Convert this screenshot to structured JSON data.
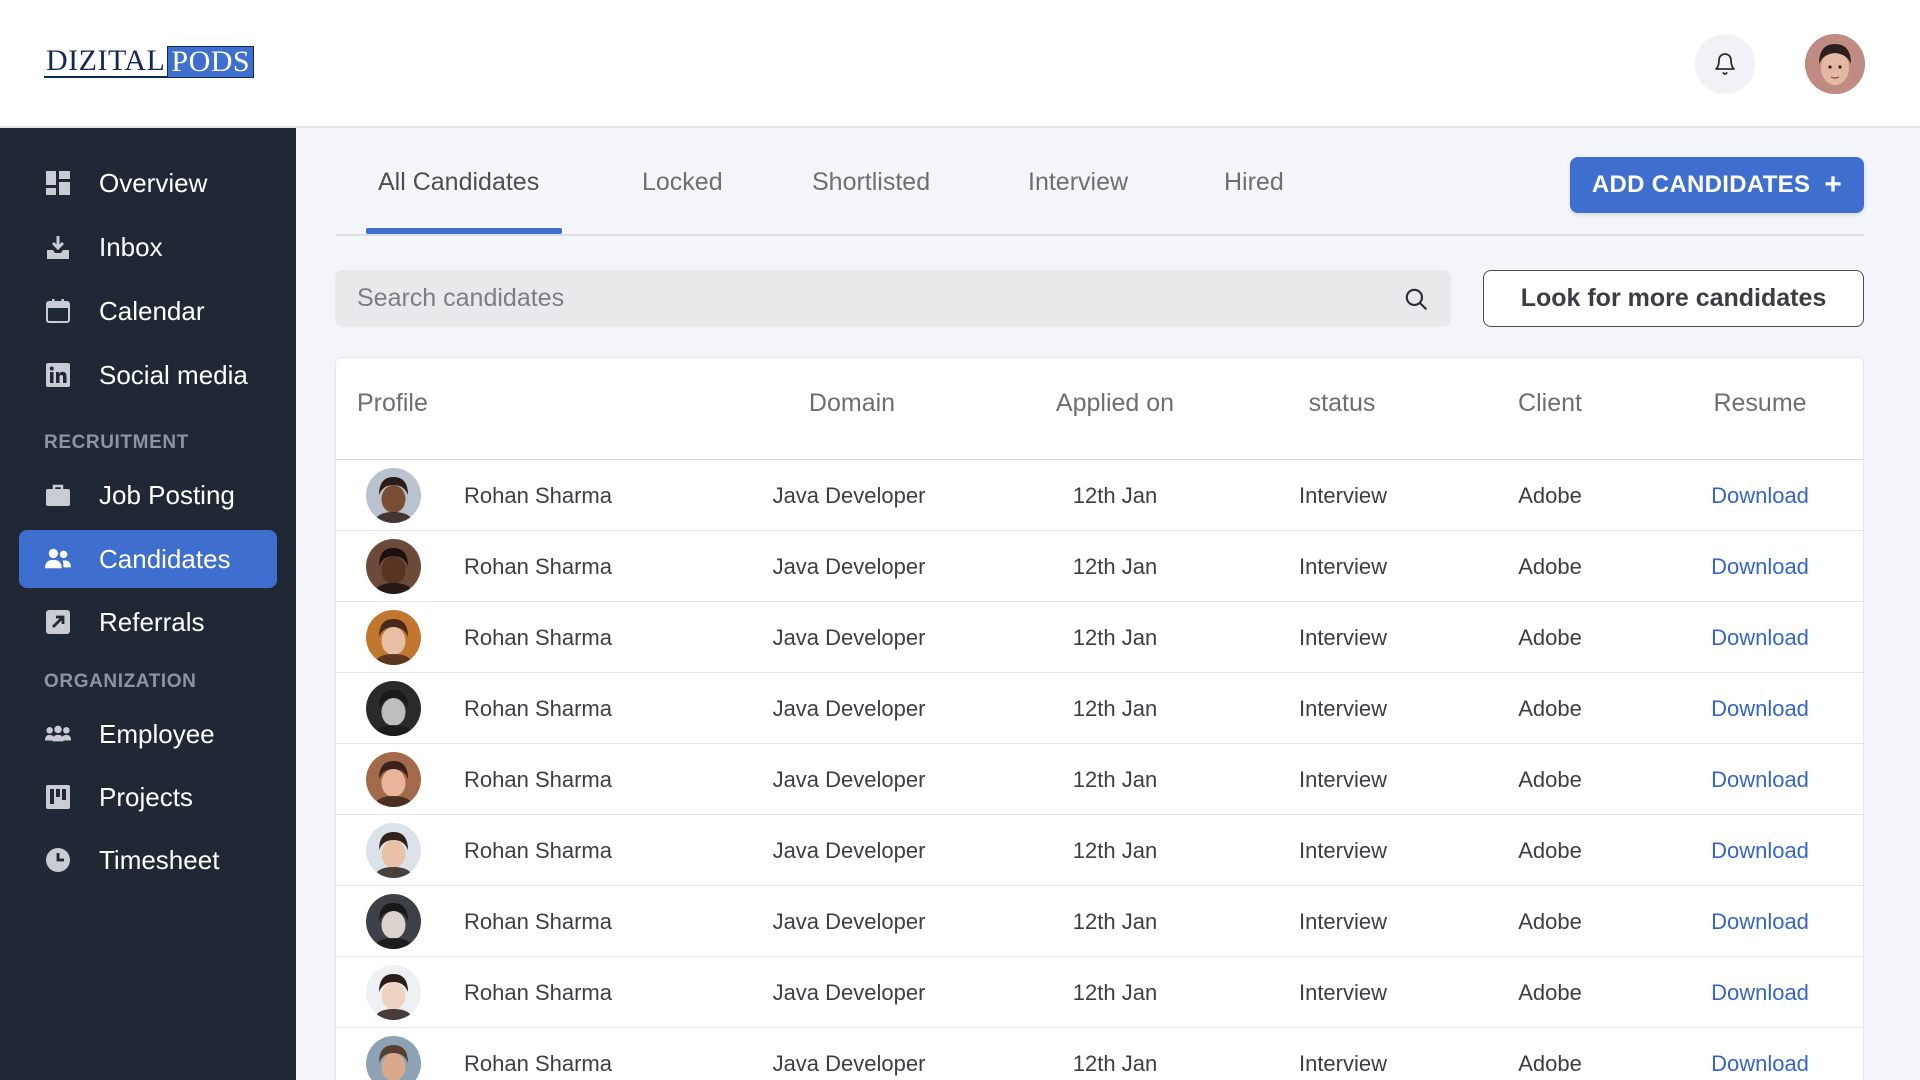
{
  "header": {
    "logo": {
      "part1": "DIZITAL",
      "part2": "PODS"
    }
  },
  "sidebar": {
    "items": [
      {
        "label": "Overview",
        "icon": "dashboard-icon"
      },
      {
        "label": "Inbox",
        "icon": "inbox-download-icon"
      },
      {
        "label": "Calendar",
        "icon": "calendar-icon"
      },
      {
        "label": "Social media",
        "icon": "linkedin-icon"
      }
    ],
    "section_recruitment": "RECRUITMENT",
    "recruitment_items": [
      {
        "label": "Job Posting",
        "icon": "briefcase-icon"
      },
      {
        "label": "Candidates",
        "icon": "people-icon",
        "active": true
      },
      {
        "label": "Referrals",
        "icon": "share-arrow-icon"
      }
    ],
    "section_organization": "ORGANIZATION",
    "organization_items": [
      {
        "label": "Employee",
        "icon": "group-icon"
      },
      {
        "label": "Projects",
        "icon": "board-icon"
      },
      {
        "label": "Timesheet",
        "icon": "clock-icon"
      }
    ]
  },
  "tabs": [
    {
      "label": "All Candidates",
      "active": true
    },
    {
      "label": "Locked"
    },
    {
      "label": "Shortlisted"
    },
    {
      "label": "Interview"
    },
    {
      "label": "Hired"
    }
  ],
  "add_button": {
    "label": "ADD CANDIDATES",
    "icon": "plus-icon"
  },
  "search": {
    "placeholder": "Search candidates",
    "value": ""
  },
  "more_button": {
    "label": "Look for more candidates"
  },
  "table": {
    "columns": [
      "Profile",
      "Domain",
      "Applied on",
      "status",
      "Client",
      "Resume"
    ],
    "rows": [
      {
        "name": "Rohan Sharma",
        "domain": "Java Developer",
        "applied_on": "12th Jan",
        "status": "Interview",
        "client": "Adobe",
        "resume": "Download"
      },
      {
        "name": "Rohan Sharma",
        "domain": "Java Developer",
        "applied_on": "12th Jan",
        "status": "Interview",
        "client": "Adobe",
        "resume": "Download"
      },
      {
        "name": "Rohan Sharma",
        "domain": "Java Developer",
        "applied_on": "12th Jan",
        "status": "Interview",
        "client": "Adobe",
        "resume": "Download"
      },
      {
        "name": "Rohan Sharma",
        "domain": "Java Developer",
        "applied_on": "12th Jan",
        "status": "Interview",
        "client": "Adobe",
        "resume": "Download"
      },
      {
        "name": "Rohan Sharma",
        "domain": "Java Developer",
        "applied_on": "12th Jan",
        "status": "Interview",
        "client": "Adobe",
        "resume": "Download"
      },
      {
        "name": "Rohan Sharma",
        "domain": "Java Developer",
        "applied_on": "12th Jan",
        "status": "Interview",
        "client": "Adobe",
        "resume": "Download"
      },
      {
        "name": "Rohan Sharma",
        "domain": "Java Developer",
        "applied_on": "12th Jan",
        "status": "Interview",
        "client": "Adobe",
        "resume": "Download"
      },
      {
        "name": "Rohan Sharma",
        "domain": "Java Developer",
        "applied_on": "12th Jan",
        "status": "Interview",
        "client": "Adobe",
        "resume": "Download"
      },
      {
        "name": "Rohan Sharma",
        "domain": "Java Developer",
        "applied_on": "12th Jan",
        "status": "Interview",
        "client": "Adobe",
        "resume": "Download"
      }
    ]
  },
  "colors": {
    "accent": "#3f6fce",
    "sidebar_bg": "#202735",
    "link": "#3565c7"
  }
}
